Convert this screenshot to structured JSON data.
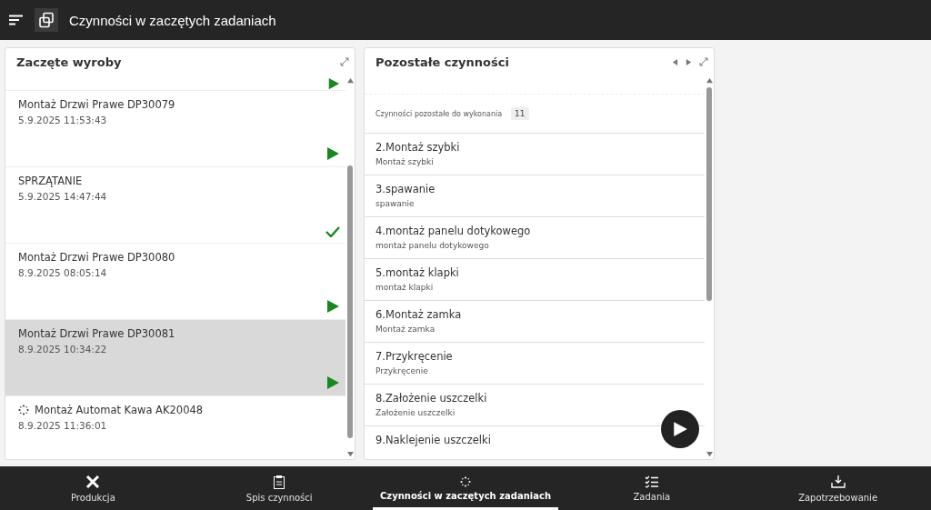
{
  "header": {
    "title": "Czynności w zaczętych zadaniach"
  },
  "started_panel": {
    "title": "Zaczęte wyroby",
    "items": [
      {
        "kind": "play",
        "selected": false
      },
      {
        "name": "Montaż Drzwi Prawe DP30079",
        "time": "5.9.2025 11:53:43",
        "kind": "play",
        "selected": false
      },
      {
        "name": "SPRZĄTANIE",
        "time": "5.9.2025 14:47:44",
        "kind": "done",
        "selected": false
      },
      {
        "name": "Montaż Drzwi Prawe DP30080",
        "time": "8.9.2025 08:05:14",
        "kind": "play",
        "selected": false
      },
      {
        "name": "Montaż Drzwi Prawe DP30081",
        "time": "8.9.2025 10:34:22",
        "kind": "play",
        "selected": true
      },
      {
        "name": "Montaż Automat Kawa AK20048",
        "time": "8.9.2025 11:36:01",
        "kind": "loading",
        "selected": false
      }
    ]
  },
  "remaining_panel": {
    "title": "Pozostałe czynności",
    "count_label": "Czynności pozostałe do wykonania",
    "count": "11",
    "items": [
      {
        "title": "2.Montaż szybki",
        "subtitle": "Montaż szybki"
      },
      {
        "title": "3.spawanie",
        "subtitle": "spawanie"
      },
      {
        "title": "4.montaż panelu dotykowego",
        "subtitle": "montaż panelu dotykowego"
      },
      {
        "title": "5.montaż klapki",
        "subtitle": "montaż klapki"
      },
      {
        "title": "6.Montaż zamka",
        "subtitle": "Montaż zamka"
      },
      {
        "title": "7.Przykręcenie",
        "subtitle": "Przykręcenie"
      },
      {
        "title": "8.Założenie uszczelki",
        "subtitle": "Założenie uszczelki"
      },
      {
        "title": "9.Naklejenie uszczelki"
      }
    ]
  },
  "bottom_nav": [
    {
      "label": "Produkcja",
      "kind": "tools",
      "selected": false
    },
    {
      "label": "Spis czynności",
      "kind": "clipboard",
      "selected": false
    },
    {
      "label": "Czynności w zaczętych zadaniach",
      "kind": "spinner",
      "selected": true
    },
    {
      "label": "Zadania",
      "kind": "checklist",
      "selected": false
    },
    {
      "label": "Zapotrzebowanie",
      "kind": "download",
      "selected": false
    }
  ]
}
